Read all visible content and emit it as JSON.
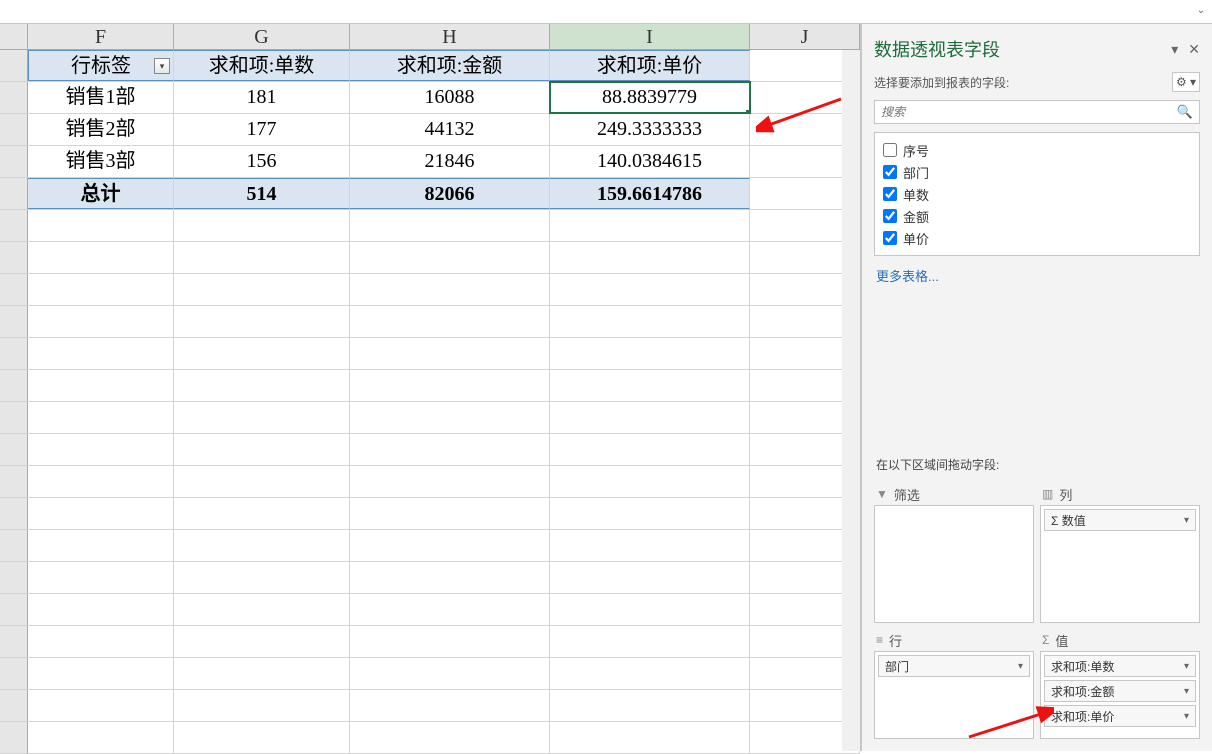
{
  "columns": {
    "F": "F",
    "G": "G",
    "H": "H",
    "I": "I",
    "J": "J"
  },
  "pivot": {
    "headers": {
      "rowlabel": "行标签",
      "g": "求和项:单数",
      "h": "求和项:金额",
      "i": "求和项:单价"
    },
    "rows": [
      {
        "label": "销售1部",
        "g": "181",
        "h": "16088",
        "i": "88.8839779"
      },
      {
        "label": "销售2部",
        "g": "177",
        "h": "44132",
        "i": "249.3333333"
      },
      {
        "label": "销售3部",
        "g": "156",
        "h": "21846",
        "i": "140.0384615"
      }
    ],
    "total": {
      "label": "总计",
      "g": "514",
      "h": "82066",
      "i": "159.6614786"
    }
  },
  "pane": {
    "title": "数据透视表字段",
    "subtitle": "选择要添加到报表的字段:",
    "search_placeholder": "搜索",
    "fields": [
      {
        "label": "序号",
        "checked": false
      },
      {
        "label": "部门",
        "checked": true
      },
      {
        "label": "单数",
        "checked": true
      },
      {
        "label": "金额",
        "checked": true
      },
      {
        "label": "单价",
        "checked": true
      }
    ],
    "more_tables": "更多表格...",
    "areas_label": "在以下区域间拖动字段:",
    "areas": {
      "filter": {
        "title": "筛选",
        "items": []
      },
      "columns": {
        "title": "列",
        "items": [
          "Σ 数值"
        ]
      },
      "rows": {
        "title": "行",
        "items": [
          "部门"
        ]
      },
      "values": {
        "title": "值",
        "items": [
          "求和项:单数",
          "求和项:金额",
          "求和项:单价"
        ]
      }
    }
  }
}
